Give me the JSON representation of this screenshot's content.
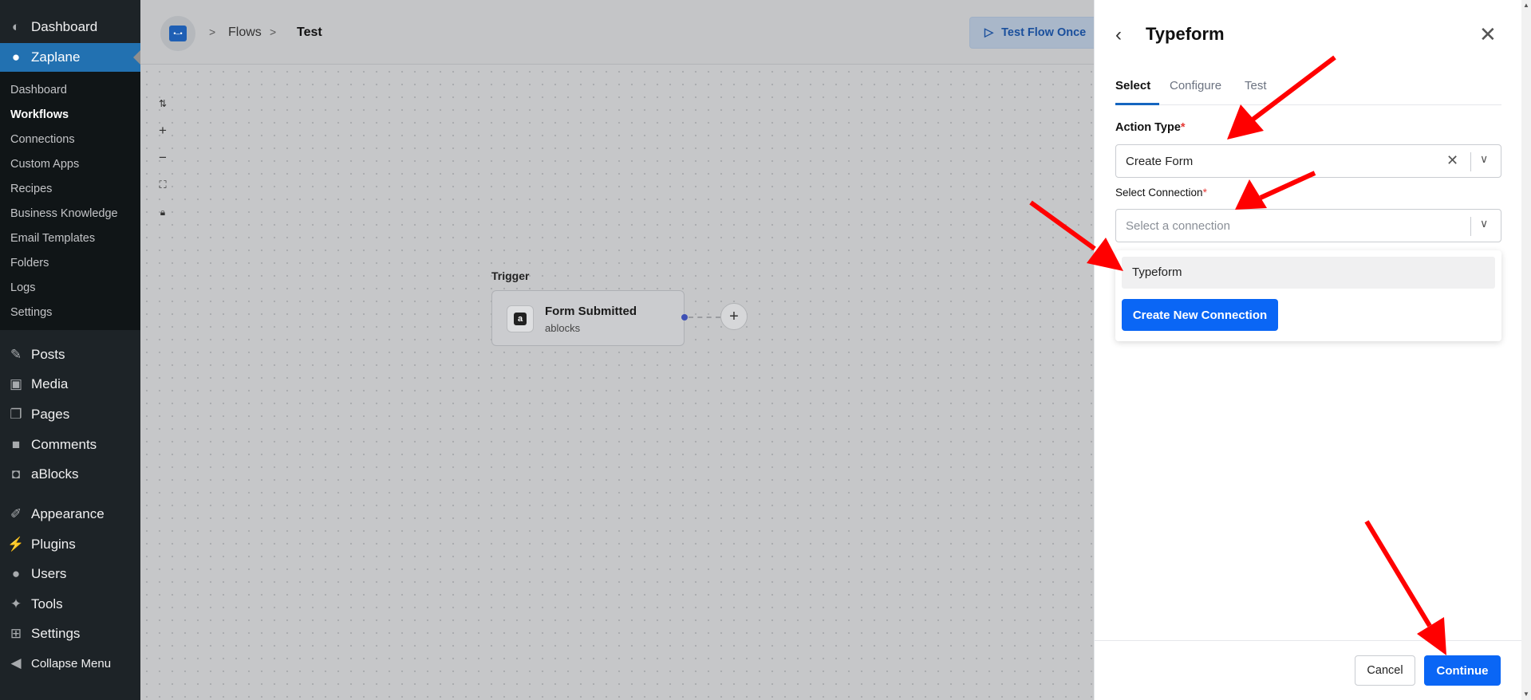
{
  "wp_menu": {
    "top": [
      {
        "label": "Dashboard",
        "icon": "dashboard-icon"
      },
      {
        "label": "Zaplane",
        "icon": "zaplane-icon"
      }
    ],
    "submenu": [
      "Dashboard",
      "Workflows",
      "Connections",
      "Custom Apps",
      "Recipes",
      "Business Knowledge",
      "Email Templates",
      "Folders",
      "Logs",
      "Settings"
    ],
    "bottom": [
      {
        "label": "Posts",
        "icon": "pin-icon"
      },
      {
        "label": "Media",
        "icon": "media-icon"
      },
      {
        "label": "Pages",
        "icon": "pages-icon"
      },
      {
        "label": "Comments",
        "icon": "comments-icon"
      },
      {
        "label": "aBlocks",
        "icon": "ablocks-icon"
      },
      {
        "label": "Appearance",
        "icon": "appearance-icon"
      },
      {
        "label": "Plugins",
        "icon": "plugins-icon"
      },
      {
        "label": "Users",
        "icon": "users-icon"
      },
      {
        "label": "Tools",
        "icon": "tools-icon"
      },
      {
        "label": "Settings",
        "icon": "settings-icon"
      },
      {
        "label": "Collapse Menu",
        "icon": "collapse-icon"
      }
    ]
  },
  "header": {
    "breadcrumbs": [
      "Flows",
      "Test"
    ],
    "test_flow_label": "Test Flow Once"
  },
  "canvas": {
    "trigger_label": "Trigger",
    "trigger_title": "Form Submitted",
    "trigger_subtitle": "ablocks"
  },
  "panel": {
    "title": "Typeform",
    "tabs": [
      "Select",
      "Configure",
      "Test"
    ],
    "action_type": {
      "label": "Action Type",
      "value": "Create Form"
    },
    "connection": {
      "label": "Select Connection",
      "placeholder": "Select a connection"
    },
    "dropdown_options": [
      "Typeform"
    ],
    "create_connection_label": "Create New Connection",
    "cancel_label": "Cancel",
    "continue_label": "Continue"
  },
  "colors": {
    "accent": "#0a66f5",
    "wp_sidebar": "#1d2327",
    "wp_active": "#2271b1",
    "annotation_arrow": "#ff0000"
  }
}
